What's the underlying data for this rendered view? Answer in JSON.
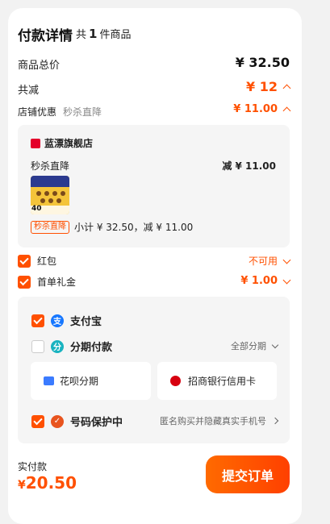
{
  "header": {
    "title": "付款详情",
    "count_prefix": "共",
    "count": "1",
    "count_suffix": "件商品"
  },
  "summary": {
    "total_label": "商品总价",
    "total_value": "¥ 32.50",
    "discount_label": "共减",
    "discount_value": "¥ 12",
    "shop_discount_label": "店铺优惠",
    "shop_discount_type": "秒杀直降",
    "shop_discount_value": "¥ 11.00"
  },
  "shop": {
    "name": "蓝漂旗舰店",
    "promo_label": "秒杀直降",
    "promo_value": "减 ¥ 11.00",
    "tag": "秒杀直降",
    "subtotal": "小计 ¥ 32.50，减 ¥ 11.00",
    "product_badge": "40"
  },
  "benefits": [
    {
      "label": "红包",
      "value": "不可用",
      "checked": true
    },
    {
      "label": "首单礼金",
      "value": "¥ 1.00",
      "checked": true
    }
  ],
  "payment": {
    "alipay_label": "支付宝",
    "installment_label": "分期付款",
    "installment_value": "全部分期",
    "huabei_label": "花呗分期",
    "cmb_label": "招商银行信用卡",
    "privacy_label": "号码保护中",
    "privacy_value": "匿名购买并隐藏真实手机号"
  },
  "footer": {
    "paid_label": "实付款",
    "paid_currency": "¥",
    "paid_value": "20.50",
    "submit_label": "提交订单"
  },
  "colors": {
    "accent": "#ff5000",
    "alipay": "#1677ff",
    "installment": "#19b3c0",
    "privacy": "#e8541e"
  }
}
